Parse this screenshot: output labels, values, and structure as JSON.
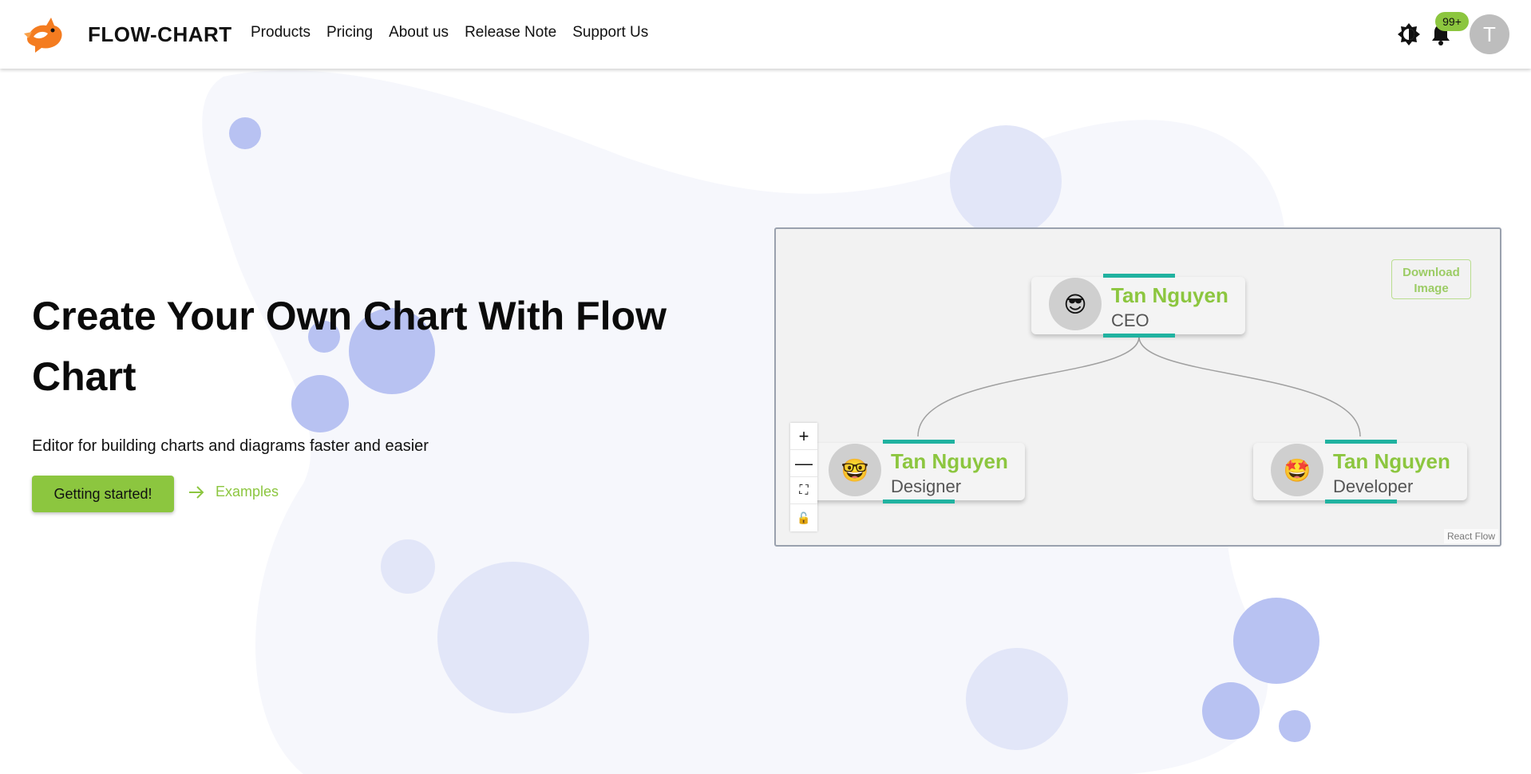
{
  "header": {
    "brand": "FLOW-CHART",
    "nav": [
      "Products",
      "Pricing",
      "About us",
      "Release Note",
      "Support Us"
    ],
    "notification_count": "99+",
    "avatar_initial": "T",
    "icons": {
      "logo": "dragon-logo",
      "theme": "brightness-icon",
      "bell": "bell-icon"
    }
  },
  "hero": {
    "title": "Create Your Own Chart With Flow Chart",
    "subtitle": "Editor for building charts and diagrams faster and easier",
    "cta_label": "Getting started!",
    "examples_label": "Examples"
  },
  "flow": {
    "download_label": "Download Image",
    "nodes": [
      {
        "name": "Tan Nguyen",
        "role": "CEO",
        "emoji": "😎"
      },
      {
        "name": "Tan Nguyen",
        "role": "Designer",
        "emoji": "🤓"
      },
      {
        "name": "Tan Nguyen",
        "role": "Developer",
        "emoji": "🤩"
      }
    ],
    "controls": [
      "+",
      "—",
      "⛶",
      "🔓"
    ],
    "attribution": "React Flow"
  },
  "colors": {
    "accent": "#8cc63f",
    "teal": "#20b2a0",
    "bubble_light": "#e2e6f8",
    "bubble_dark": "#b8c2f2",
    "blob": "#f6f7fc"
  }
}
